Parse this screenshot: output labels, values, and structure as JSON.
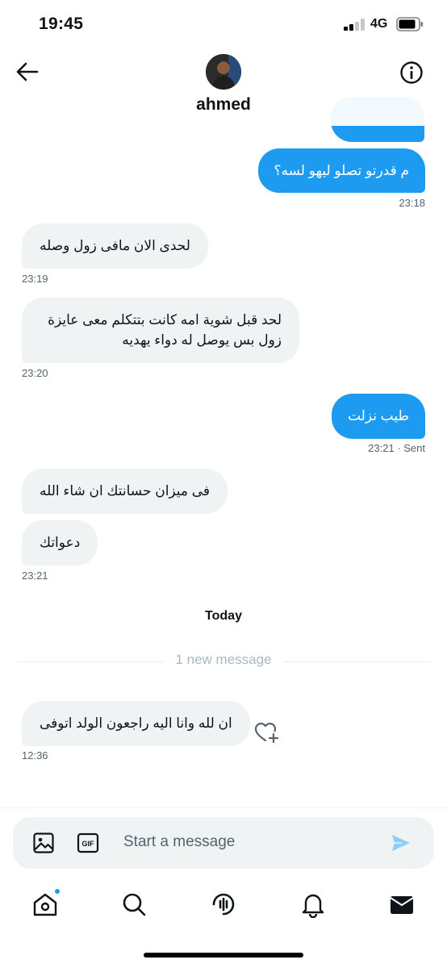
{
  "status_bar": {
    "time": "19:45",
    "network": "4G"
  },
  "header": {
    "contact_name": "ahmed"
  },
  "messages": [
    {
      "text": "م قدرتو تصلو ليهو لسه؟",
      "time": "23:18"
    },
    {
      "text": "لحدى الان مافى زول وصله",
      "time": "23:19"
    },
    {
      "line1": "لحد قبل شوية امه كانت بتتكلم معى عايزة",
      "line2": "زول بس يوصل له دواء يهديه",
      "time": "23:20"
    },
    {
      "text": "طيب نزلت",
      "time": "23:21 · Sent"
    },
    {
      "text": "فى ميزان حسانتك ان شاء الله"
    },
    {
      "text": "دعواتك",
      "time": "23:21"
    },
    {
      "text": "ان لله وانا اليه راجعون الولد اتوفى",
      "time": "12:36"
    }
  ],
  "day_label": "Today",
  "new_message_label": "1 new message",
  "composer": {
    "placeholder": "Start a message"
  },
  "icons": {
    "back": "arrow-left-icon",
    "info": "info-icon",
    "image": "image-icon",
    "gif": "gif-icon",
    "send": "send-icon",
    "react": "heart-plus-icon",
    "home": "home-icon",
    "search": "search-icon",
    "spaces": "spaces-icon",
    "notifications": "bell-icon",
    "messages": "envelope-icon"
  },
  "colors": {
    "accent": "#1d9bf0",
    "bubble_in": "#eff3f4",
    "muted": "#536471"
  }
}
